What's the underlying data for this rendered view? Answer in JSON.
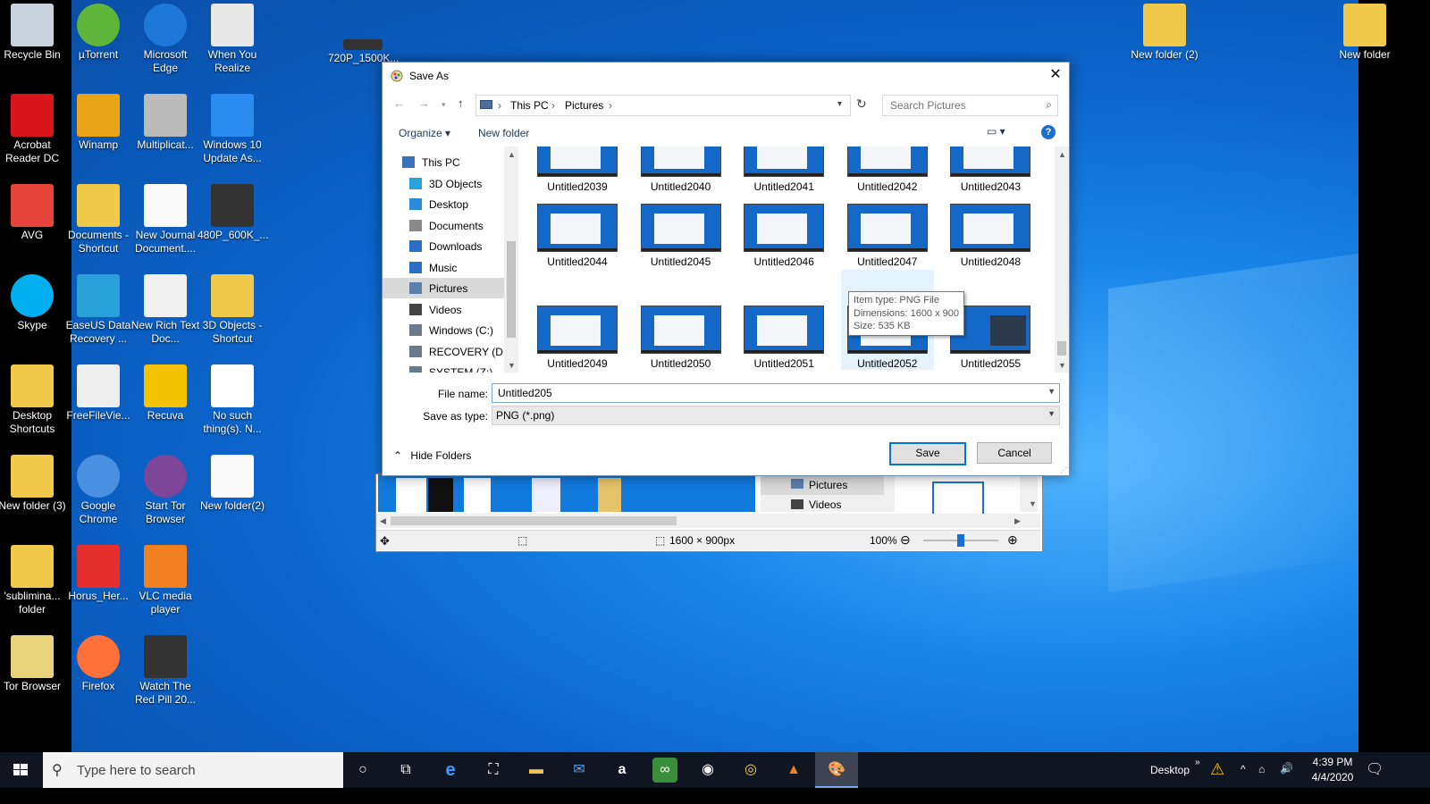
{
  "desktop": {
    "icons": [
      {
        "label": "Recycle Bin",
        "icon": "recycle-bin-icon"
      },
      {
        "label": "µTorrent",
        "icon": "utorrent-icon"
      },
      {
        "label": "Microsoft Edge",
        "icon": "edge-icon"
      },
      {
        "label": "When You Realize",
        "icon": "image-file-icon"
      },
      {
        "label": "720P_1500K...",
        "icon": "video-file-icon"
      },
      {
        "label": "Acrobat Reader DC",
        "icon": "acrobat-icon"
      },
      {
        "label": "Winamp",
        "icon": "winamp-icon"
      },
      {
        "label": "Multiplicat...",
        "icon": "file-icon"
      },
      {
        "label": "Windows 10 Update As...",
        "icon": "windows-update-icon"
      },
      {
        "label": "AVG",
        "icon": "avg-icon"
      },
      {
        "label": "Documents - Shortcut",
        "icon": "folder-icon"
      },
      {
        "label": "New Journal Document....",
        "icon": "document-icon"
      },
      {
        "label": "480P_600K_...",
        "icon": "video-file-icon"
      },
      {
        "label": "Skype",
        "icon": "skype-icon"
      },
      {
        "label": "EaseUS Data Recovery ...",
        "icon": "easeus-icon"
      },
      {
        "label": "New Rich Text Doc...",
        "icon": "rtf-document-icon"
      },
      {
        "label": "3D Objects - Shortcut",
        "icon": "folder-icon"
      },
      {
        "label": "Desktop Shortcuts",
        "icon": "folder-icon"
      },
      {
        "label": "FreeFileVie...",
        "icon": "freefileviewer-icon"
      },
      {
        "label": "Recuva",
        "icon": "recuva-icon"
      },
      {
        "label": "No such thing(s). N...",
        "icon": "winamp-file-icon"
      },
      {
        "label": "New folder (3)",
        "icon": "folder-icon"
      },
      {
        "label": "Google Chrome",
        "icon": "chrome-icon"
      },
      {
        "label": "Start Tor Browser",
        "icon": "tor-icon"
      },
      {
        "label": "New folder(2)",
        "icon": "document-icon"
      },
      {
        "label": "'sublimina... folder",
        "icon": "folder-icon"
      },
      {
        "label": "Horus_Her...",
        "icon": "pdf-icon"
      },
      {
        "label": "VLC media player",
        "icon": "vlc-icon"
      },
      {
        "label": "Tor Browser",
        "icon": "tor-folder-icon"
      },
      {
        "label": "Firefox",
        "icon": "firefox-icon"
      },
      {
        "label": "Watch The Red Pill 20...",
        "icon": "video-file-icon"
      },
      {
        "label": "New folder (2)",
        "icon": "folder-icon"
      },
      {
        "label": "New folder",
        "icon": "folder-icon"
      }
    ]
  },
  "paint": {
    "nav_items": [
      "Pictures",
      "Videos"
    ],
    "status_size": "1600 × 900px",
    "zoom": "100%"
  },
  "dialog": {
    "title": "Save As",
    "close": "✕",
    "breadcrumb": [
      "This PC",
      "Pictures"
    ],
    "search_placeholder": "Search Pictures",
    "organize": "Organize",
    "new_folder": "New folder",
    "help": "?",
    "nav_items": [
      {
        "label": "This PC",
        "icon": "this-pc-icon"
      },
      {
        "label": "3D Objects",
        "icon": "3d-objects-icon"
      },
      {
        "label": "Desktop",
        "icon": "desktop-folder-icon"
      },
      {
        "label": "Documents",
        "icon": "documents-icon"
      },
      {
        "label": "Downloads",
        "icon": "downloads-icon"
      },
      {
        "label": "Music",
        "icon": "music-icon"
      },
      {
        "label": "Pictures",
        "icon": "pictures-icon"
      },
      {
        "label": "Videos",
        "icon": "videos-icon"
      },
      {
        "label": "Windows (C:)",
        "icon": "drive-icon"
      },
      {
        "label": "RECOVERY (D:)",
        "icon": "drive-icon"
      },
      {
        "label": "SYSTEM (Z:)",
        "icon": "drive-icon"
      }
    ],
    "files": [
      "Untitled2039",
      "Untitled2040",
      "Untitled2041",
      "Untitled2042",
      "Untitled2043",
      "Untitled2044",
      "Untitled2045",
      "Untitled2046",
      "Untitled2047",
      "Untitled2048",
      "Untitled2049",
      "Untitled2050",
      "Untitled2051",
      "Untitled2052",
      "Untitled2055"
    ],
    "tooltip": {
      "line1": "Item type: PNG File",
      "line2": "Dimensions: 1600 x 900",
      "line3": "Size: 535 KB"
    },
    "file_name_label": "File name:",
    "file_name_value": "Untitled205",
    "save_type_label": "Save as type:",
    "save_type_value": "PNG (*.png)",
    "hide_folders": "Hide Folders",
    "save": "Save",
    "cancel": "Cancel"
  },
  "taskbar": {
    "search_placeholder": "Type here to search",
    "desktop_label": "Desktop",
    "time": "4:39 PM",
    "date": "4/4/2020"
  }
}
